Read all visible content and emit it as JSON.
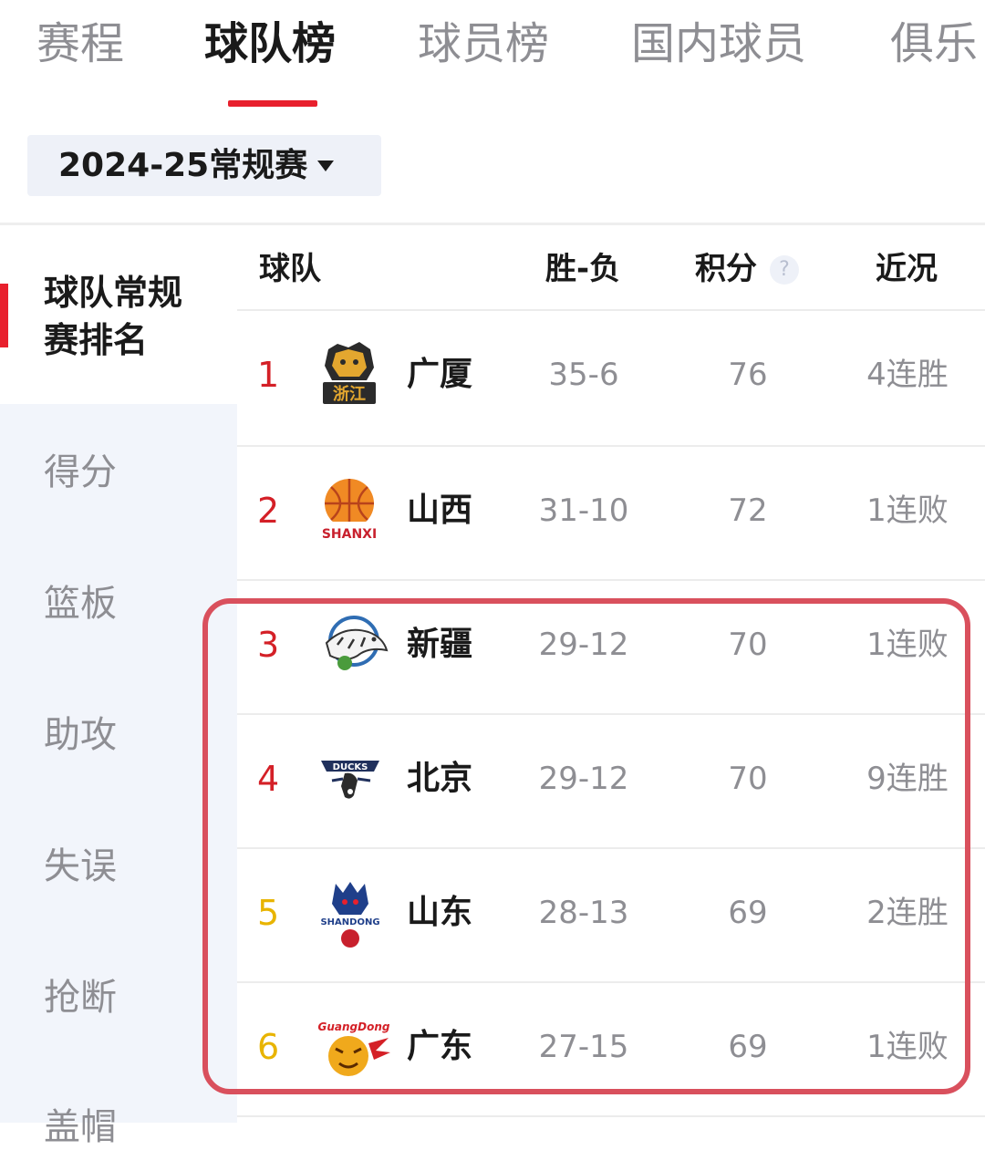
{
  "tabs": [
    "赛程",
    "球队榜",
    "球员榜",
    "国内球员",
    "俱乐"
  ],
  "season_select": "2024-25常规赛",
  "sidebar": {
    "active": "球队常规赛排名",
    "items": [
      "得分",
      "篮板",
      "助攻",
      "失误",
      "抢断",
      "盖帽"
    ]
  },
  "table": {
    "headers": {
      "team": "球队",
      "wl": "胜-负",
      "points": "积分",
      "recent": "近况"
    },
    "help_symbol": "?",
    "rows": [
      {
        "rank": "1",
        "team": "广厦",
        "wl": "35-6",
        "points": "76",
        "recent": "4连胜",
        "logo": "zhejiang-lion-logo",
        "logo_text": "浙江"
      },
      {
        "rank": "2",
        "team": "山西",
        "wl": "31-10",
        "points": "72",
        "recent": "1连败",
        "logo": "shanxi-basketball-logo",
        "logo_text": "SHANXI"
      },
      {
        "rank": "3",
        "team": "新疆",
        "wl": "29-12",
        "points": "70",
        "recent": "1连败",
        "logo": "xinjiang-tiger-logo",
        "logo_text": ""
      },
      {
        "rank": "4",
        "team": "北京",
        "wl": "29-12",
        "points": "70",
        "recent": "9连胜",
        "logo": "beijing-ducks-logo",
        "logo_text": "DUCKS"
      },
      {
        "rank": "5",
        "team": "山东",
        "wl": "28-13",
        "points": "69",
        "recent": "2连胜",
        "logo": "shandong-dragon-logo",
        "logo_text": "SHANDONG"
      },
      {
        "rank": "6",
        "team": "广东",
        "wl": "27-15",
        "points": "69",
        "recent": "1连败",
        "logo": "guangdong-tiger-logo",
        "logo_text": "GuangDong"
      }
    ]
  },
  "colors": {
    "accent": "#e8202d",
    "rank_top": "#d42027",
    "rank_mid": "#e8b400",
    "highlight_box": "#d9505d",
    "muted": "#8e8e93"
  }
}
